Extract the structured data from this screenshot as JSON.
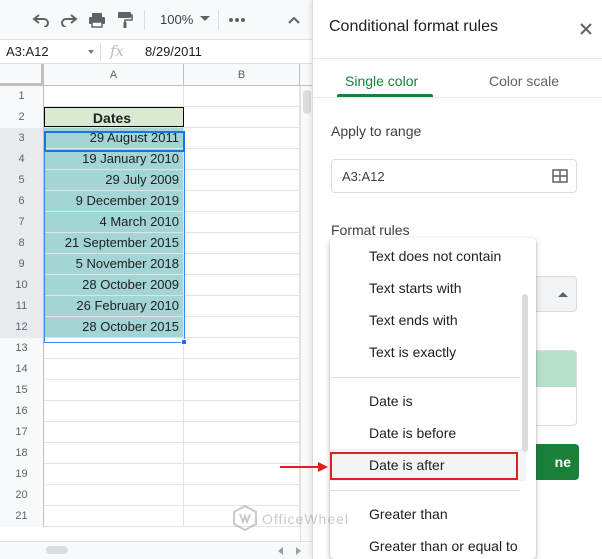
{
  "toolbar": {
    "zoom_value": "100%",
    "icons": [
      "undo-icon",
      "redo-icon",
      "print-icon",
      "paint-format-icon",
      "more-icon",
      "collapse-icon"
    ]
  },
  "formula_bar": {
    "name_box": "A3:A12",
    "fx_label": "fx",
    "value": "8/29/2011"
  },
  "columns": [
    "A",
    "B"
  ],
  "rows": [
    {
      "num": "1",
      "a": ""
    },
    {
      "num": "2",
      "a": "Dates"
    },
    {
      "num": "3",
      "a": "29 August 2011"
    },
    {
      "num": "4",
      "a": "19 January 2010"
    },
    {
      "num": "5",
      "a": "29 July 2009"
    },
    {
      "num": "6",
      "a": "9 December 2019"
    },
    {
      "num": "7",
      "a": "4 March 2010"
    },
    {
      "num": "8",
      "a": "21 September 2015"
    },
    {
      "num": "9",
      "a": "5 November 2018"
    },
    {
      "num": "10",
      "a": "28 October 2009"
    },
    {
      "num": "11",
      "a": "26 February 2010"
    },
    {
      "num": "12",
      "a": "28 October 2015"
    },
    {
      "num": "13",
      "a": ""
    },
    {
      "num": "14",
      "a": ""
    },
    {
      "num": "15",
      "a": ""
    },
    {
      "num": "16",
      "a": ""
    },
    {
      "num": "17",
      "a": ""
    },
    {
      "num": "18",
      "a": ""
    },
    {
      "num": "19",
      "a": ""
    },
    {
      "num": "20",
      "a": ""
    },
    {
      "num": "21",
      "a": ""
    }
  ],
  "panel": {
    "title": "Conditional format rules",
    "tabs": [
      "Single color",
      "Color scale"
    ],
    "active_tab": "Single color",
    "apply_label": "Apply to range",
    "range_value": "A3:A12",
    "format_rules_label": "Format rules",
    "done_label": "ne"
  },
  "menu": {
    "items": [
      "Text does not contain",
      "Text starts with",
      "Text ends with",
      "Text is exactly",
      "Date is",
      "Date is before",
      "Date is after",
      "Greater than",
      "Greater than or equal to"
    ],
    "highlighted": "Date is after"
  },
  "watermark": "OfficeWheel",
  "colors": {
    "accent_green": "#188038",
    "header_fill": "#d9ead3",
    "date_fill": "#a2d5d3",
    "annotation_red": "#e02020",
    "selection_blue": "#1a73e8"
  }
}
